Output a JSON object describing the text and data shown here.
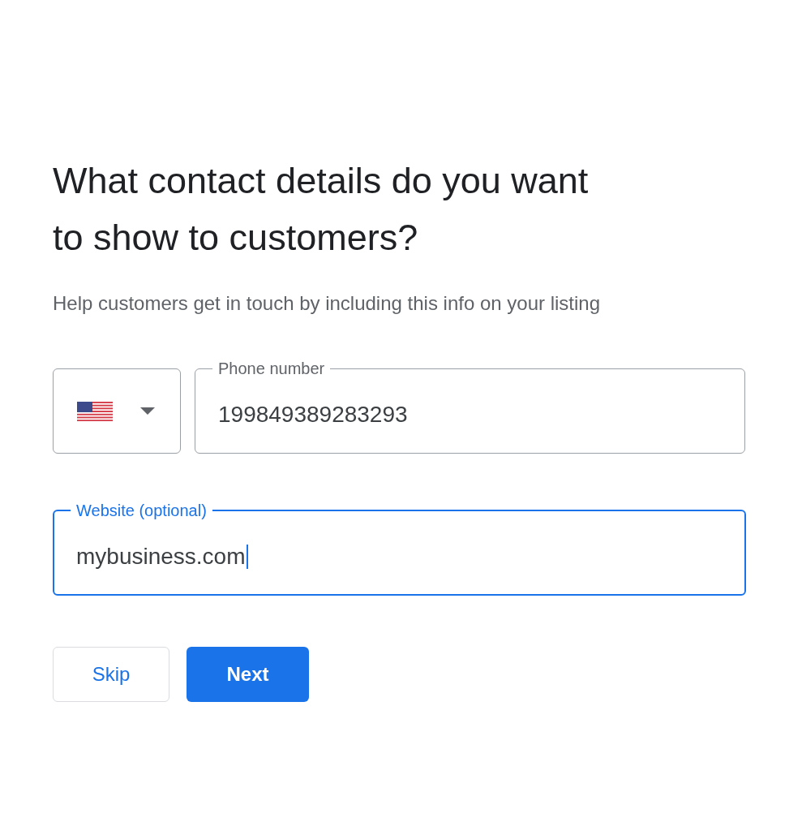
{
  "heading": "What contact details do you want to show to customers?",
  "subtitle": "Help customers get in touch by including this info on your listing",
  "phone": {
    "label": "Phone number",
    "value": "199849389283293",
    "focused": false
  },
  "website": {
    "label": "Website (optional)",
    "value": "mybusiness.com",
    "focused": true
  },
  "buttons": [
    {
      "label": "Skip",
      "kind": "secondary"
    },
    {
      "label": "Next",
      "kind": "primary"
    }
  ]
}
